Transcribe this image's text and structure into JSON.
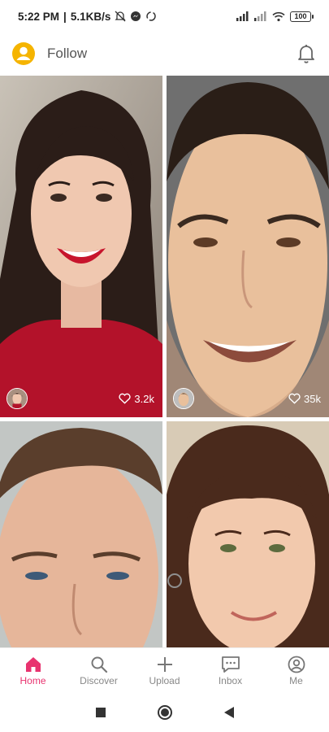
{
  "status_bar": {
    "time": "5:22 PM",
    "separator": "|",
    "speed": "5.1KB/s",
    "battery": "100"
  },
  "header": {
    "title": "Follow",
    "accent_color": "#f5b400"
  },
  "feed": {
    "items": [
      {
        "likes": "3.2k",
        "subject": "woman-red-sweater"
      },
      {
        "likes": "35k",
        "subject": "man-smiling"
      },
      {
        "likes": "",
        "subject": "man-close-up"
      },
      {
        "likes": "",
        "subject": "girl-smiling"
      }
    ]
  },
  "bottom_nav": {
    "items": [
      {
        "label": "Home",
        "icon": "home-icon",
        "active": true
      },
      {
        "label": "Discover",
        "icon": "search-icon",
        "active": false
      },
      {
        "label": "Upload",
        "icon": "plus-icon",
        "active": false
      },
      {
        "label": "Inbox",
        "icon": "chat-icon",
        "active": false
      },
      {
        "label": "Me",
        "icon": "profile-icon",
        "active": false
      }
    ],
    "active_color": "#e8336f"
  }
}
